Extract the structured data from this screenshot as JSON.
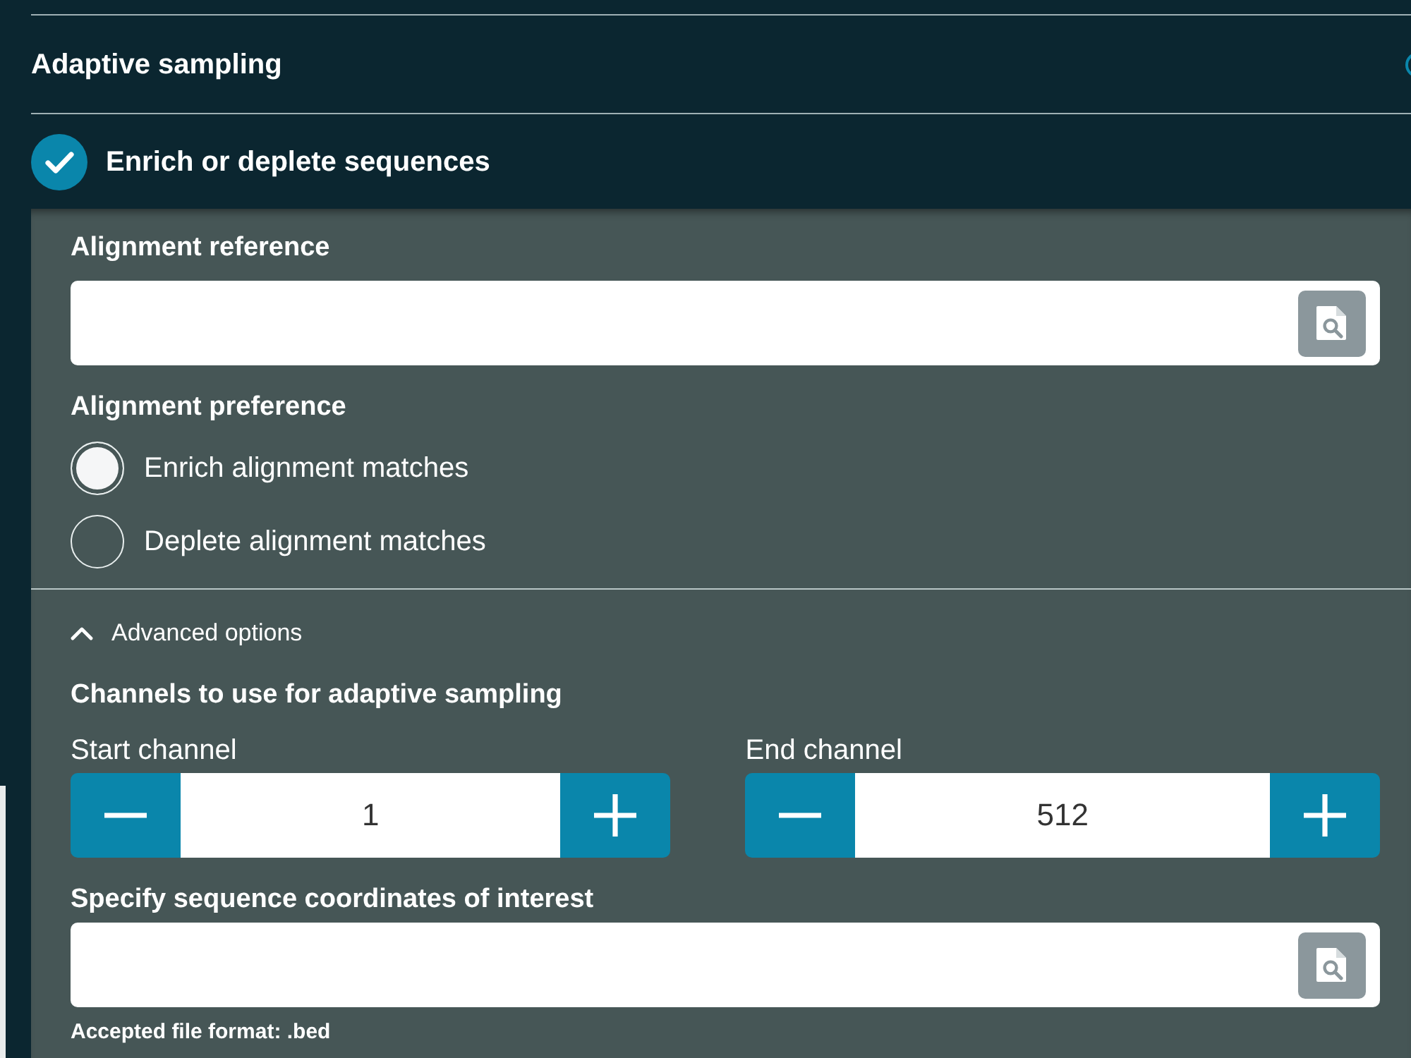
{
  "section": {
    "title": "Adaptive sampling"
  },
  "option": {
    "label": "Enrich or deplete sequences",
    "checked": true
  },
  "alignment_reference": {
    "label": "Alignment reference"
  },
  "alignment_preference": {
    "label": "Alignment preference",
    "options": [
      {
        "label": "Enrich alignment matches",
        "selected": true
      },
      {
        "label": "Deplete alignment matches",
        "selected": false
      }
    ]
  },
  "advanced_options": {
    "label": "Advanced options",
    "expanded": true,
    "channels": {
      "label": "Channels to use for adaptive sampling",
      "steppers": [
        {
          "label": "Start channel",
          "value": "1"
        },
        {
          "label": "End channel",
          "value": "512"
        }
      ]
    },
    "coordinates": {
      "label": "Specify sequence coordinates of interest",
      "hint": "Accepted file format: .bed"
    }
  }
}
